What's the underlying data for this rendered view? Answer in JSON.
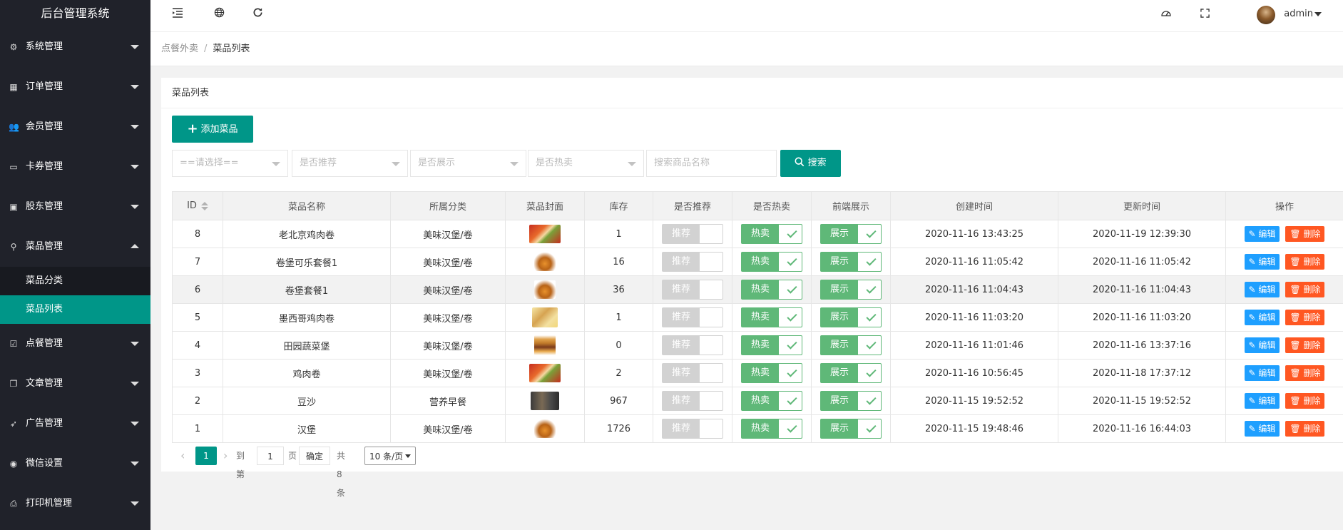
{
  "app": {
    "title": "后台管理系统"
  },
  "sidebar": {
    "items": [
      {
        "label": "系统管理",
        "icon": "gear-icon",
        "glyph": "⚙"
      },
      {
        "label": "订单管理",
        "icon": "calendar-icon",
        "glyph": "▦"
      },
      {
        "label": "会员管理",
        "icon": "users-icon",
        "glyph": "👥"
      },
      {
        "label": "卡券管理",
        "icon": "card-icon",
        "glyph": "▭"
      },
      {
        "label": "股东管理",
        "icon": "contact-icon",
        "glyph": "▣"
      },
      {
        "label": "菜品管理",
        "icon": "bicycle-icon",
        "glyph": "⚲",
        "expanded": true,
        "children": [
          {
            "label": "菜品分类"
          },
          {
            "label": "菜品列表",
            "active": true
          }
        ]
      },
      {
        "label": "点餐管理",
        "icon": "checkbox-icon",
        "glyph": "☑"
      },
      {
        "label": "文章管理",
        "icon": "copy-icon",
        "glyph": "❐"
      },
      {
        "label": "广告管理",
        "icon": "rocket-icon",
        "glyph": "➶"
      },
      {
        "label": "微信设置",
        "icon": "wechat-icon",
        "glyph": "◉"
      },
      {
        "label": "打印机管理",
        "icon": "printer-icon",
        "glyph": "⎙"
      }
    ]
  },
  "header": {
    "icons": [
      "menu-fold-icon",
      "globe-icon",
      "refresh-icon",
      "theme-icon",
      "fullscreen-icon"
    ],
    "user": "admin"
  },
  "breadcrumb": {
    "parent": "点餐外卖",
    "current": "菜品列表"
  },
  "card": {
    "title": "菜品列表",
    "add_label": "添加菜品",
    "filters": {
      "category": "==请选择==",
      "recommend": "是否推荐",
      "display": "是否展示",
      "hot": "是否热卖",
      "search_placeholder": "搜索商品名称",
      "search_label": "搜索"
    }
  },
  "table": {
    "columns": [
      "ID",
      "菜品名称",
      "所属分类",
      "菜品封面",
      "库存",
      "是否推荐",
      "是否热卖",
      "前端展示",
      "创建时间",
      "更新时间",
      "操作"
    ],
    "switch_labels": {
      "recommend": "推荐",
      "hot": "热卖",
      "display": "展示"
    },
    "action_labels": {
      "edit": "编辑",
      "delete": "删除"
    },
    "rows": [
      {
        "id": "8",
        "name": "老北京鸡肉卷",
        "category": "美味汉堡/卷",
        "cover": "roll",
        "stock": "1",
        "recommend": false,
        "hot": true,
        "display": true,
        "created": "2020-11-16 13:43:25",
        "updated": "2020-11-19 12:39:30"
      },
      {
        "id": "7",
        "name": "卷堡可乐套餐1",
        "category": "美味汉堡/卷",
        "cover": "meal",
        "stock": "16",
        "recommend": false,
        "hot": true,
        "display": true,
        "created": "2020-11-16 11:05:42",
        "updated": "2020-11-16 11:05:42"
      },
      {
        "id": "6",
        "name": "卷堡套餐1",
        "category": "美味汉堡/卷",
        "cover": "meal",
        "stock": "36",
        "recommend": false,
        "hot": true,
        "display": true,
        "created": "2020-11-16 11:04:43",
        "updated": "2020-11-16 11:04:43"
      },
      {
        "id": "5",
        "name": "墨西哥鸡肉卷",
        "category": "美味汉堡/卷",
        "cover": "wrap",
        "stock": "1",
        "recommend": false,
        "hot": true,
        "display": true,
        "created": "2020-11-16 11:03:20",
        "updated": "2020-11-16 11:03:20"
      },
      {
        "id": "4",
        "name": "田园蔬菜堡",
        "category": "美味汉堡/卷",
        "cover": "burger",
        "stock": "0",
        "recommend": false,
        "hot": true,
        "display": true,
        "created": "2020-11-16 11:01:46",
        "updated": "2020-11-16 13:37:16"
      },
      {
        "id": "3",
        "name": "鸡肉卷",
        "category": "美味汉堡/卷",
        "cover": "roll",
        "stock": "2",
        "recommend": false,
        "hot": true,
        "display": true,
        "created": "2020-11-16 10:56:45",
        "updated": "2020-11-18 17:37:12"
      },
      {
        "id": "2",
        "name": "豆沙",
        "category": "营养早餐",
        "cover": "shop",
        "stock": "967",
        "recommend": false,
        "hot": true,
        "display": true,
        "created": "2020-11-15 19:52:52",
        "updated": "2020-11-15 19:52:52"
      },
      {
        "id": "1",
        "name": "汉堡",
        "category": "美味汉堡/卷",
        "cover": "meal",
        "stock": "1726",
        "recommend": false,
        "hot": true,
        "display": true,
        "created": "2020-11-15 19:48:46",
        "updated": "2020-11-16 16:44:03"
      }
    ]
  },
  "pager": {
    "current": "1",
    "goto_label": "到第",
    "goto_value": "1",
    "page_unit": "页",
    "confirm": "确定",
    "total": "共 8 条",
    "page_size": "10 条/页"
  },
  "colors": {
    "accent": "#009688",
    "sidebar": "#20222a",
    "switch_on": "#5fb878",
    "edit": "#1e9fff",
    "delete": "#ff5722"
  }
}
